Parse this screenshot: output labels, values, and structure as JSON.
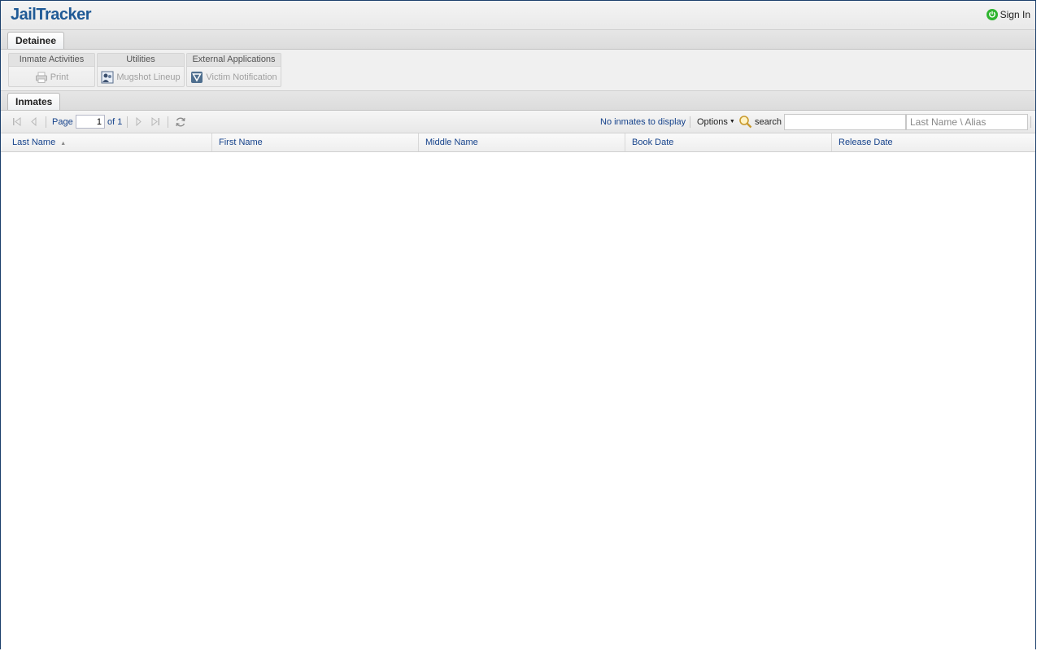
{
  "app": {
    "title": "JailTracker",
    "sign_in": "Sign In"
  },
  "top_tabs": [
    {
      "label": "Detainee"
    }
  ],
  "toolbar": {
    "groups": [
      {
        "title": "Inmate Activities",
        "button": "Print",
        "icon": "printer-icon"
      },
      {
        "title": "Utilities",
        "button": "Mugshot Lineup",
        "icon": "mugshot-icon"
      },
      {
        "title": "External Applications",
        "button": "Victim Notification",
        "icon": "vine-icon"
      }
    ]
  },
  "sub_tabs": [
    {
      "label": "Inmates"
    }
  ],
  "pager": {
    "page_label": "Page",
    "page_value": "1",
    "of_label": "of 1",
    "status": "No inmates to display",
    "options_label": "Options",
    "search_label": "search",
    "search_value": "",
    "alias_placeholder": "Last Name \\ Alias"
  },
  "columns": [
    {
      "label": "Last Name",
      "sorted": "asc"
    },
    {
      "label": "First Name"
    },
    {
      "label": "Middle Name"
    },
    {
      "label": "Book Date"
    },
    {
      "label": "Release Date"
    }
  ],
  "rows": [],
  "colors": {
    "brand": "#1f5a96",
    "link": "#15428b",
    "power": "#2fb52f"
  }
}
